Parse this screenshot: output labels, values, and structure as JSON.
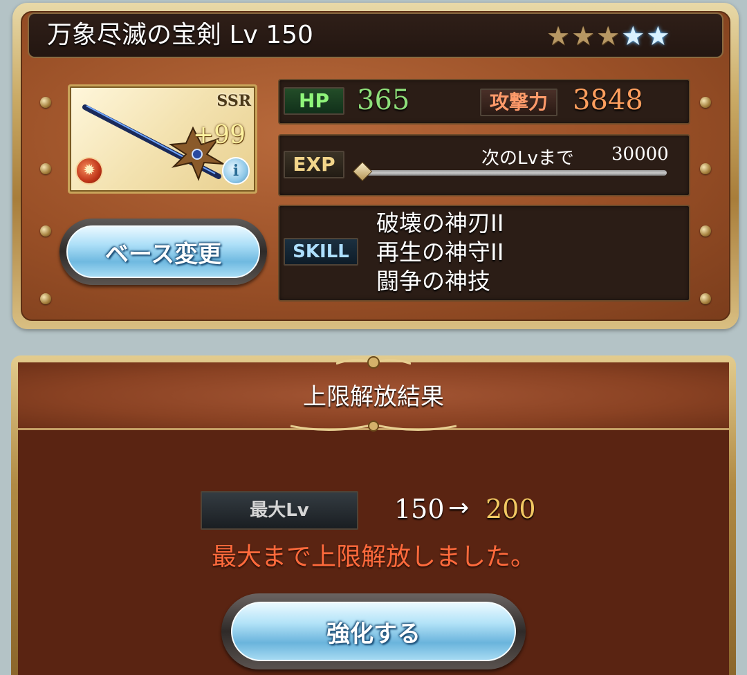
{
  "weapon": {
    "title": "万象尽滅の宝剣 Lv 150",
    "stars": [
      {
        "type": "bronze",
        "icon": "bronze-star-icon"
      },
      {
        "type": "bronze",
        "icon": "bronze-star-icon"
      },
      {
        "type": "bronze",
        "icon": "bronze-star-icon"
      },
      {
        "type": "blue",
        "icon": "blue-star-icon"
      },
      {
        "type": "blue",
        "icon": "blue-star-icon"
      }
    ],
    "rarity": "SSR",
    "plus": "+99",
    "element_icon": "fire-element-icon",
    "info_icon": "info-icon",
    "info_glyph": "i"
  },
  "stats": {
    "hp_tag": "HP",
    "hp_value": "365",
    "atk_tag": "攻撃力",
    "atk_value": "3848",
    "exp_tag": "EXP",
    "exp_next_label": "次のLvまで",
    "exp_next_value": "30000",
    "exp_progress": 0.0
  },
  "skills": {
    "tag": "SKILL",
    "items": [
      "破壊の神刃II",
      "再生の神守II",
      "闘争の神技"
    ]
  },
  "buttons": {
    "base_change": "ベース変更",
    "upgrade": "強化する"
  },
  "result": {
    "title": "上限解放結果",
    "max_lv_tag": "最大Lv",
    "lv_from": "150",
    "arrow": "→",
    "lv_to": "200",
    "message": "最大まで上限解放しました。"
  },
  "colors": {
    "hp": "#8ee07a",
    "atk": "#ff9f5e",
    "lv_to": "#f2c862",
    "message": "#ff6a3c"
  }
}
